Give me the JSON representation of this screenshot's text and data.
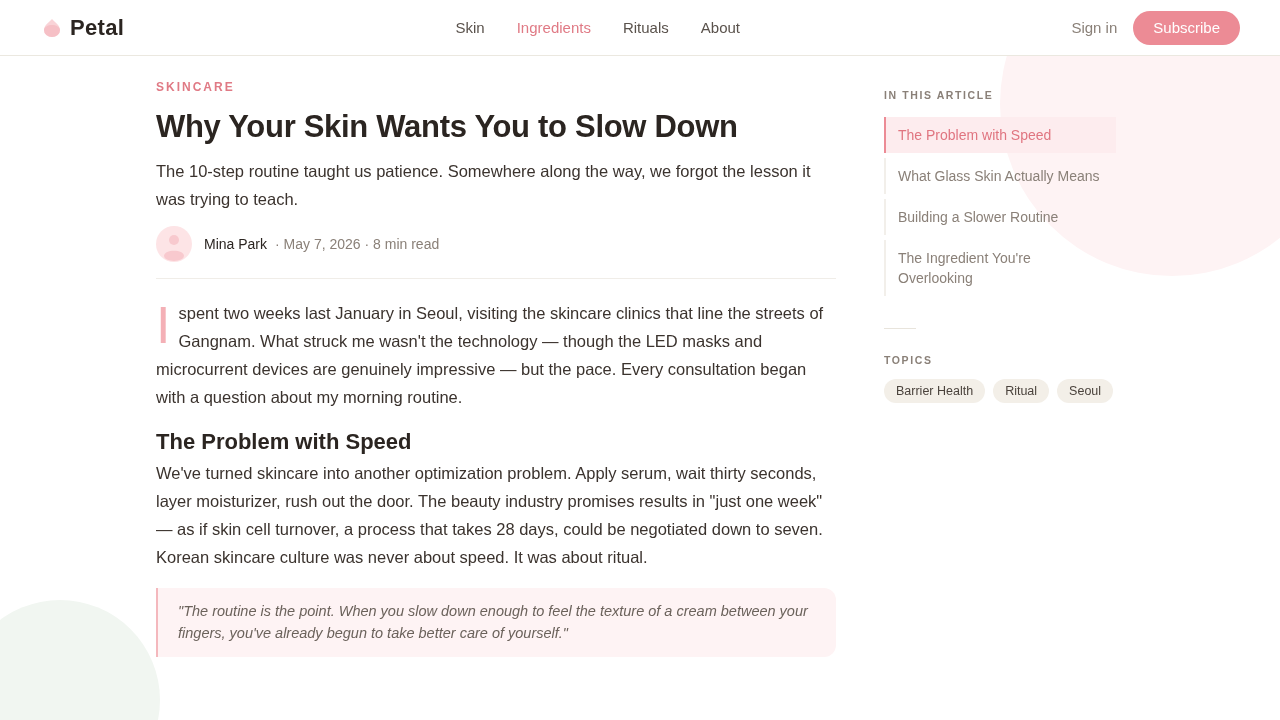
{
  "header": {
    "logo": "Petal",
    "nav": [
      {
        "label": "Skin",
        "selected": false
      },
      {
        "label": "Ingredients",
        "selected": true
      },
      {
        "label": "Rituals",
        "selected": false
      },
      {
        "label": "About",
        "selected": false
      }
    ],
    "sign_in": "Sign in",
    "subscribe": "Subscribe"
  },
  "article": {
    "category": "SKINCARE",
    "title": "Why Your Skin Wants You to Slow Down",
    "dek": "The 10-step routine taught us patience. Somewhere along the way, we forgot the lesson it was trying to teach.",
    "author": {
      "name": "Mina Park",
      "meta": "· May 7, 2026 · 8 min read"
    },
    "body": [
      {
        "kind": "paragraph",
        "drop_cap": true,
        "text": "I spent two weeks last January in Seoul, visiting the skincare clinics that line the streets of Gangnam. What struck me wasn't the technology — though the LED masks and microcurrent devices are genuinely impressive — but the pace. Every consultation began with a question about my morning routine."
      },
      {
        "kind": "heading",
        "text": "The Problem with Speed"
      },
      {
        "kind": "paragraph",
        "drop_cap": false,
        "text": "We've turned skincare into another optimization problem. Apply serum, wait thirty seconds, layer moisturizer, rush out the door. The beauty industry promises results in \"just one week\" — as if skin cell turnover, a process that takes 28 days, could be negotiated down to seven. Korean skincare culture was never about speed. It was about ritual."
      },
      {
        "kind": "quote",
        "text": "\"The routine is the point. When you slow down enough to feel the texture of a cream between your fingers, you've already begun to take better care of yourself.\""
      }
    ]
  },
  "sidebar": {
    "toc_title": "IN THIS ARTICLE",
    "toc": [
      {
        "label": "The Problem with Speed",
        "selected": true
      },
      {
        "label": "What Glass Skin Actually Means",
        "selected": false
      },
      {
        "label": "Building a Slower Routine",
        "selected": false
      },
      {
        "label": "The Ingredient You're Overlooking",
        "selected": false
      }
    ],
    "topics_title": "TOPICS",
    "topics": [
      "Barrier Health",
      "Ritual",
      "Seoul"
    ]
  }
}
